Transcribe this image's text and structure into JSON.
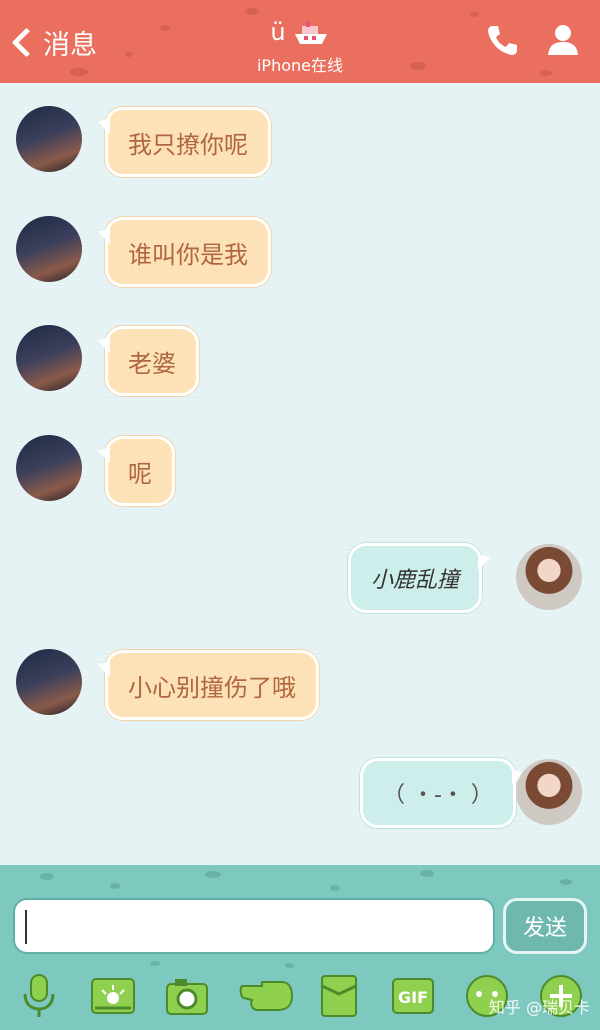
{
  "header": {
    "back_label": "消息",
    "title": "ü",
    "subtitle": "iPhone在线",
    "call_icon": "phone-icon",
    "profile_icon": "person-icon"
  },
  "messages": [
    {
      "side": "left",
      "text": "我只撩你呢"
    },
    {
      "side": "left",
      "text": "谁叫你是我"
    },
    {
      "side": "left",
      "text": "老婆"
    },
    {
      "side": "left",
      "text": "呢"
    },
    {
      "side": "right",
      "text": "小鹿乱撞"
    },
    {
      "side": "left",
      "text": "小心别撞伤了哦"
    },
    {
      "side": "right",
      "text": "（ ・-・ ）"
    }
  ],
  "composer": {
    "input_value": "",
    "send_label": "发送"
  },
  "toolbar": {
    "gif_label": "GIF",
    "icons": [
      "microphone-icon",
      "image-icon",
      "camera-icon",
      "poke-icon",
      "file-icon",
      "gif-icon",
      "emoji-icon",
      "plus-icon"
    ]
  },
  "watermark": "知乎 @瑞贝卡",
  "colors": {
    "header": "#ea6f5f",
    "footer": "#7ec9bf",
    "bubble_left": "#fde2b8",
    "bubble_right": "#cdeeea"
  }
}
